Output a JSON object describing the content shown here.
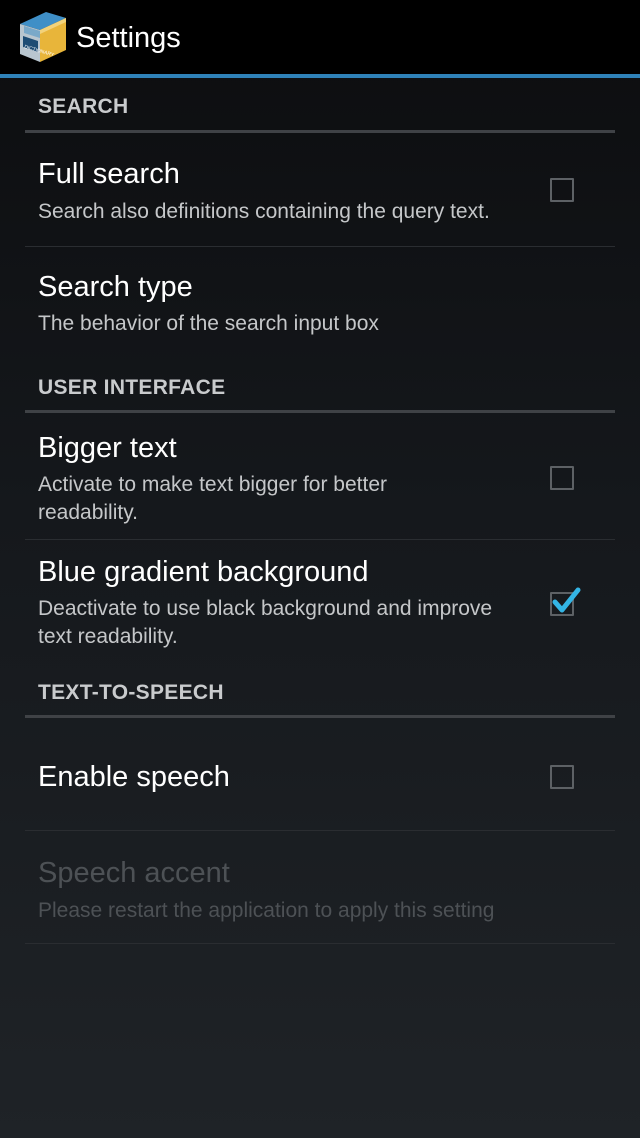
{
  "action_bar": {
    "title": "Settings",
    "app_icon": "dictionary-book-icon",
    "accent_color": "#2f82b8"
  },
  "sections": {
    "search": {
      "header": "SEARCH",
      "full_search": {
        "title": "Full search",
        "summary": "Search also definitions containing the query text.",
        "checked": false
      },
      "search_type": {
        "title": "Search type",
        "summary": "The behavior of the search input box"
      }
    },
    "user_interface": {
      "header": "USER INTERFACE",
      "bigger_text": {
        "title": "Bigger text",
        "summary": "Activate to make text bigger for better readability.",
        "checked": false
      },
      "blue_gradient": {
        "title": "Blue gradient background",
        "summary": "Deactivate to use black background and improve text readability.",
        "checked": true
      }
    },
    "text_to_speech": {
      "header": "TEXT-TO-SPEECH",
      "enable_speech": {
        "title": "Enable speech",
        "checked": false
      },
      "speech_accent": {
        "title": "Speech accent",
        "summary": "Please restart the application to apply this setting",
        "enabled": false
      }
    }
  }
}
